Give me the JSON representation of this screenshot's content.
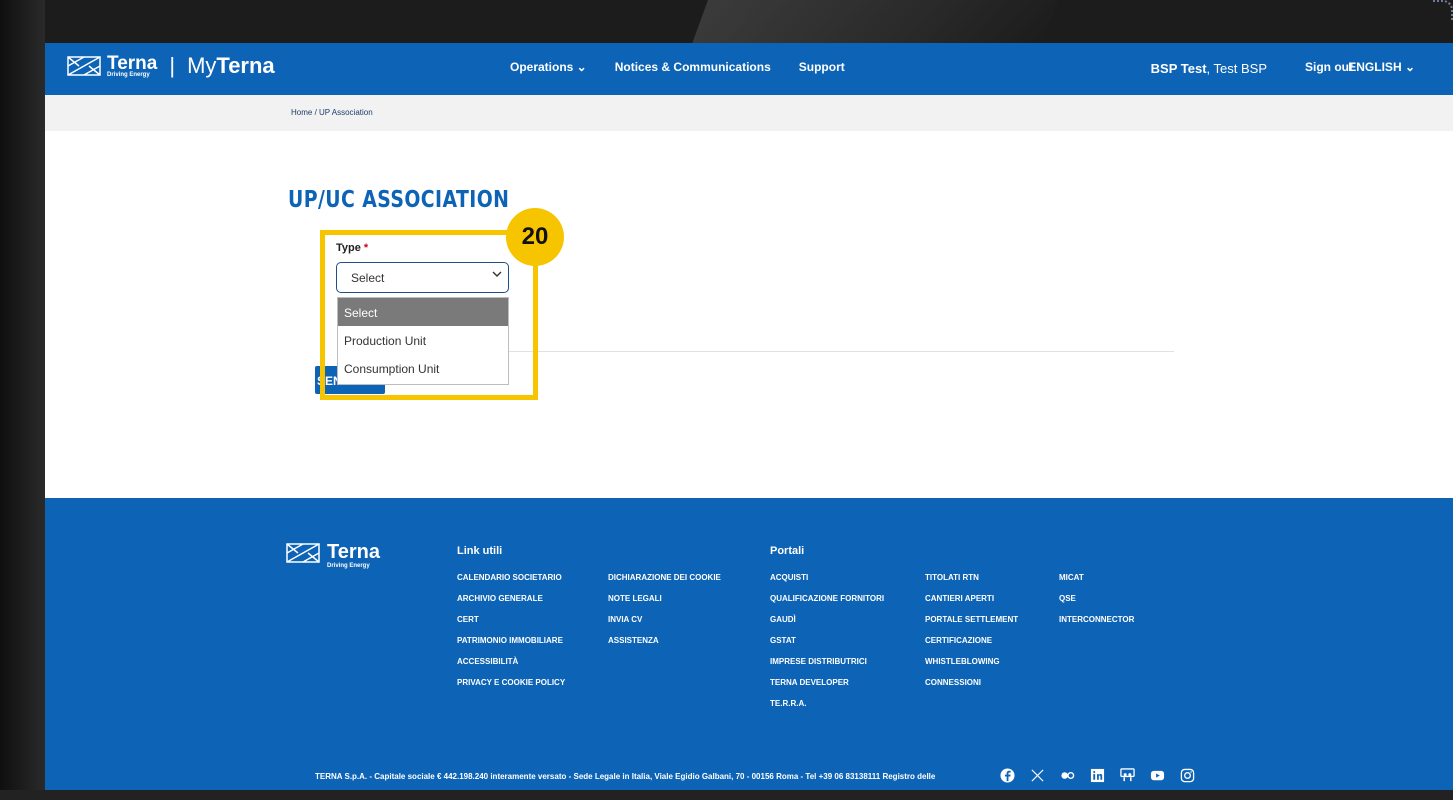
{
  "header": {
    "logo_text": "Terna",
    "logo_sub": "Driving Energy",
    "logo_my": "My",
    "logo_my_bold": "Terna",
    "nav": [
      {
        "label": "Operations ⌄"
      },
      {
        "label": "Notices & Communications"
      },
      {
        "label": "Support"
      }
    ],
    "user_bold": "BSP Test",
    "user_rest": ", Test BSP",
    "signout": "Sign out",
    "language": "ENGLISH ⌄"
  },
  "breadcrumb": "Home  /  UP Association",
  "main": {
    "title": "UP/UC ASSOCIATION",
    "type_label": "Type",
    "type_required": "*",
    "select_value": "Select",
    "dropdown_options": [
      "Select",
      "Production Unit",
      "Consumption Unit"
    ],
    "send_label": "SEND",
    "step_number": "20"
  },
  "footer": {
    "logo_text": "Terna",
    "logo_sub": "Driving Energy",
    "link_utili_title": "Link utili",
    "portali_title": "Portali",
    "col1": [
      "CALENDARIO SOCIETARIO",
      "ARCHIVIO GENERALE",
      "CERT",
      "PATRIMONIO IMMOBILIARE",
      "ACCESSIBILITÀ",
      "PRIVACY E COOKIE POLICY"
    ],
    "col2": [
      "DICHIARAZIONE DEI COOKIE",
      "NOTE LEGALI",
      "INVIA CV",
      "ASSISTENZA"
    ],
    "col3": [
      "ACQUISTI",
      "QUALIFICAZIONE FORNITORI",
      "GAUDÌ",
      "GSTAT",
      "IMPRESE DISTRIBUTRICI",
      "TERNA DEVELOPER",
      "TE.R.R.A."
    ],
    "col4": [
      "TITOLATI RTN",
      "CANTIERI APERTI",
      "PORTALE SETTLEMENT",
      "CERTIFICAZIONE",
      "WHISTLEBLOWING",
      "CONNESSIONI"
    ],
    "col5": [
      "MICAT",
      "QSE",
      "INTERCONNECTOR"
    ],
    "legal": "TERNA S.p.A. - Capitale sociale € 442.198.240 interamente versato - Sede Legale in Italia, Viale Egidio Galbani, 70 - 00156 Roma - Tel +39 06 83138111 Registro delle",
    "social_icons": [
      "facebook-icon",
      "x-icon",
      "flickr-icon",
      "linkedin-icon",
      "slideshare-icon",
      "youtube-icon",
      "instagram-icon"
    ]
  },
  "colors": {
    "brand_blue": "#0d63b5",
    "highlight_yellow": "#f7c400"
  }
}
